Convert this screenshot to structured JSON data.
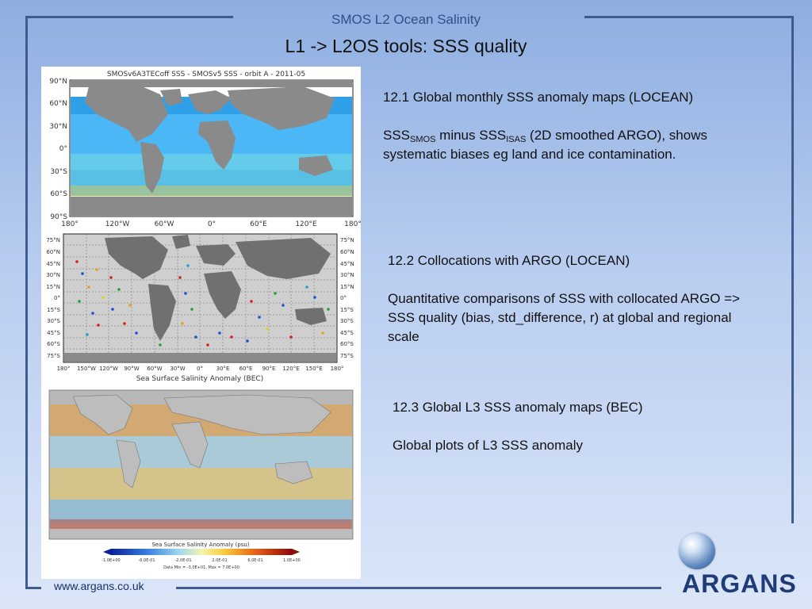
{
  "header": {
    "org_title": "SMOS L2 Ocean Salinity",
    "slide_title": "L1 -> L2OS tools: SSS quality"
  },
  "maps": {
    "map1": {
      "title": "SMOSv6A3TECoff SSS - SMOSv5 SSS - orbit A - 2011-05",
      "lat_labels": [
        "90°N",
        "60°N",
        "30°N",
        "0°",
        "30°S",
        "60°S",
        "90°S"
      ],
      "lon_labels": [
        "180°",
        "120°W",
        "60°W",
        "0°",
        "60°E",
        "120°E",
        "180°"
      ]
    },
    "map2": {
      "lat_labels": [
        "75°N",
        "60°N",
        "45°N",
        "30°N",
        "15°N",
        "0°",
        "15°S",
        "30°S",
        "45°S",
        "60°S",
        "75°S"
      ],
      "lon_labels": [
        "180°",
        "150°W",
        "120°W",
        "90°W",
        "60°W",
        "30°W",
        "0°",
        "30°E",
        "60°E",
        "90°E",
        "120°E",
        "150°E",
        "180°"
      ],
      "caption": "Sea Surface Salinity Anomaly (BEC)"
    },
    "map3": {
      "colorbar_title": "Sea Surface Salinity Anomaly (psu)",
      "colorbar_ticks": [
        "-1.0E+00",
        "-6.0E-01",
        "-2.0E-01",
        "2.0E-01",
        "6.0E-01",
        "1.0E+00"
      ],
      "data_range": "Data Min = -3.0E+01, Max = 7.0E+00"
    }
  },
  "sections": {
    "s1": {
      "heading": "12.1 Global monthly SSS anomaly maps (LOCEAN)",
      "sss1": "SSS",
      "sub1": "SMOS",
      "minus": " minus SSS",
      "sub2": "ISAS",
      "rest": " (2D smoothed ARGO), shows systematic biases eg land and  ice contamination."
    },
    "s2": {
      "heading": "12.2 Collocations with ARGO (LOCEAN)",
      "body": "Quantitative comparisons of SSS with collocated ARGO => SSS quality  (bias, std_difference, r) at global and regional scale"
    },
    "s3": {
      "heading": "12.3 Global L3 SSS anomaly maps (BEC)",
      "body": "Global plots of L3 SSS anomaly"
    }
  },
  "footer": {
    "url": "www.argans.co.uk",
    "logo_text": "ARGANS"
  },
  "colors": {
    "frame": "#3f5c8c",
    "org_title": "#2e4f8a",
    "logo": "#1f3b78"
  }
}
